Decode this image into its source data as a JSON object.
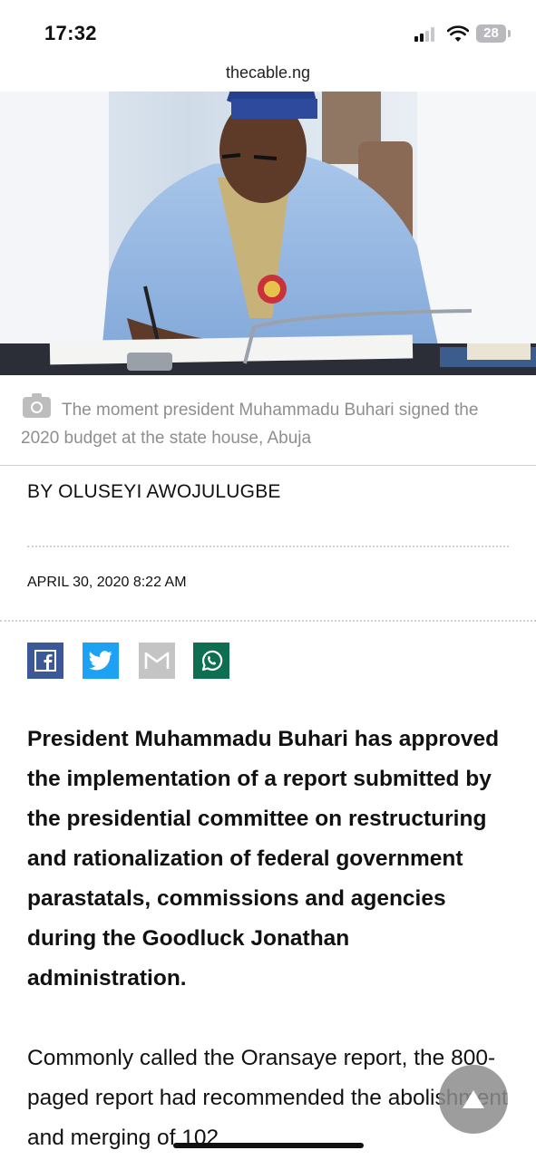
{
  "status_bar": {
    "time": "17:32",
    "battery": "28",
    "signal_bars_active": 2,
    "signal_bars_total": 4
  },
  "browser": {
    "url": "thecable.ng"
  },
  "hero_image": {
    "icon": "photo-of-man-signing-document"
  },
  "caption": {
    "icon": "camera-icon",
    "text": "The moment president Muhammadu Buhari signed the 2020 budget at the state house, Abuja"
  },
  "article": {
    "byline": "BY OLUSEYI AWOJULUGBE",
    "date": "APRIL 30, 2020 8:22 AM",
    "share": [
      {
        "name": "facebook",
        "icon": "facebook-icon",
        "color": "#3b5998"
      },
      {
        "name": "twitter",
        "icon": "twitter-icon",
        "color": "#1da1f2"
      },
      {
        "name": "gmail",
        "icon": "gmail-icon",
        "color": "#c4c4c4"
      },
      {
        "name": "whatsapp",
        "icon": "whatsapp-icon",
        "color": "#0d6e52"
      }
    ],
    "lead": "President Muhammadu Buhari has approved the implementation of a report submitted by the presidential committee on restructuring and rationalization of federal government parastatals, commissions and agencies during the Goodluck Jonathan administration.",
    "paragraph": "Commonly called the Oransaye report, the 800-paged report had recommended the abolishment and merging of 102"
  },
  "controls": {
    "scroll_top_icon": "arrow-up-icon"
  }
}
